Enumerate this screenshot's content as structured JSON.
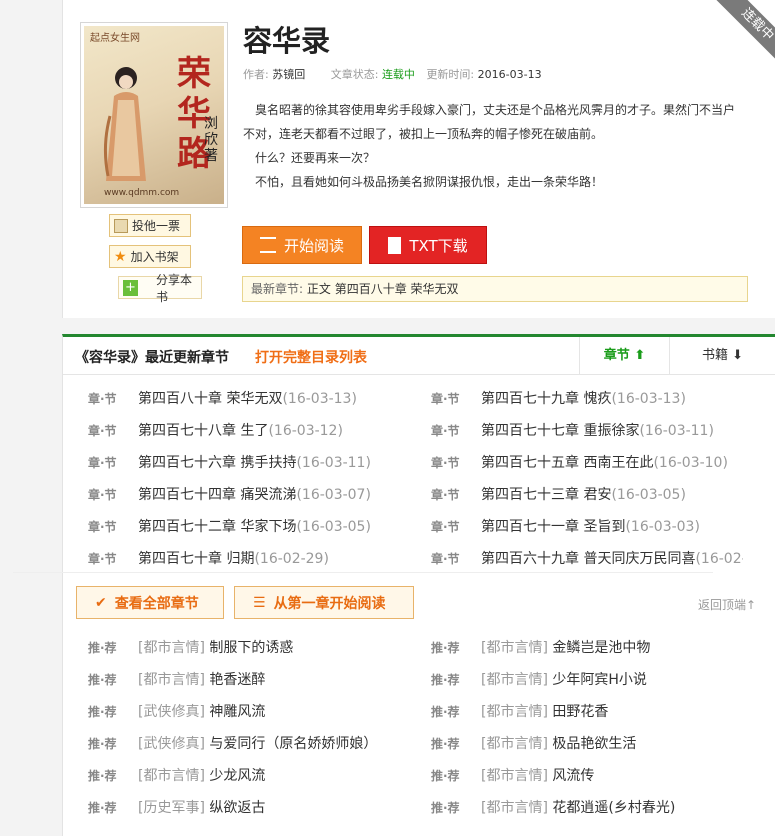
{
  "book": {
    "title": "容华录",
    "author_label": "作者:",
    "author": "苏镜回",
    "status_label": "文章状态:",
    "status": "连载中",
    "updated_label": "更新时间:",
    "updated": "2016-03-13",
    "corner_badge": "连载中",
    "intro": [
      "　臭名昭著的徐其容使用卑劣手段嫁入豪门，丈夫还是个品格光风霁月的才子。果然门不当户不对，连老天都看不过眼了，被扣上一顶私奔的帽子惨死在破庙前。",
      "　什么？还要再来一次？",
      "　不怕，且看她如何斗极品扬美名掀阴谋报仇恨，走出一条荣华路！"
    ],
    "cover": {
      "brand": "起点女生网",
      "title": "荣华路",
      "author": "浏欣著",
      "url": "www.qdmm.com"
    }
  },
  "side_buttons": {
    "vote": "投他一票",
    "shelf": "加入书架",
    "share": "分享本书"
  },
  "actions": {
    "start_read": "开始阅读",
    "txt_download": "TXT下载"
  },
  "latest": {
    "label": "最新章节:",
    "value": "正文 第四百八十章 荣华无双"
  },
  "chapters_panel": {
    "title": "《容华录》最近更新章节",
    "open_toc": "打开完整目录列表",
    "tab_chapter": "章节",
    "tab_books": "书籍",
    "tag": "章·节",
    "chapters": [
      {
        "name": "第四百八十章 荣华无双",
        "date": "(16-03-13)"
      },
      {
        "name": "第四百七十九章 愧疚",
        "date": "(16-03-13)"
      },
      {
        "name": "第四百七十八章 生了",
        "date": "(16-03-12)"
      },
      {
        "name": "第四百七十七章 重振徐家",
        "date": "(16-03-11)"
      },
      {
        "name": "第四百七十六章 携手扶持",
        "date": "(16-03-11)"
      },
      {
        "name": "第四百七十五章 西南王在此",
        "date": "(16-03-10)"
      },
      {
        "name": "第四百七十四章 痛哭流涕",
        "date": "(16-03-07)"
      },
      {
        "name": "第四百七十三章 君安",
        "date": "(16-03-05)"
      },
      {
        "name": "第四百七十二章 华家下场",
        "date": "(16-03-05)"
      },
      {
        "name": "第四百七十一章 圣旨到",
        "date": "(16-03-03)"
      },
      {
        "name": "第四百七十章 归期",
        "date": "(16-02-29)"
      },
      {
        "name": "第四百六十九章 普天同庆万民同喜",
        "date": "(16-02-"
      }
    ],
    "view_all": "查看全部章节",
    "read_from_first": "从第一章开始阅读",
    "back_top": "返回顶端↑"
  },
  "recommend": {
    "tag": "推·荐",
    "items": [
      {
        "cat": "[都市言情]",
        "name": "制服下的诱惑"
      },
      {
        "cat": "[都市言情]",
        "name": "金鳞岂是池中物"
      },
      {
        "cat": "[都市言情]",
        "name": "艳香迷醉"
      },
      {
        "cat": "[都市言情]",
        "name": "少年阿宾H小说"
      },
      {
        "cat": "[武侠修真]",
        "name": "神雕风流"
      },
      {
        "cat": "[都市言情]",
        "name": "田野花香"
      },
      {
        "cat": "[武侠修真]",
        "name": "与爱同行（原名娇娇师娘）"
      },
      {
        "cat": "[都市言情]",
        "name": "极品艳欲生活"
      },
      {
        "cat": "[都市言情]",
        "name": "少龙风流"
      },
      {
        "cat": "[都市言情]",
        "name": "风流传"
      },
      {
        "cat": "[历史军事]",
        "name": "纵欲返古"
      },
      {
        "cat": "[都市言情]",
        "name": "花都逍遥(乡村春光)"
      }
    ]
  },
  "colors": {
    "accent_orange": "#f48323",
    "accent_red": "#e32424",
    "status_green": "#1a9c1a",
    "panel_green": "#23872f"
  }
}
